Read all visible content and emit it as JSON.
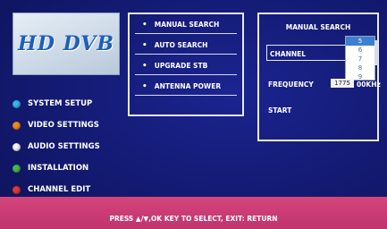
{
  "logo": {
    "text": "HD DVB"
  },
  "main_menu": {
    "items": [
      {
        "label": "SYSTEM SETUP",
        "color": "#35b5e8"
      },
      {
        "label": "VIDEO SETTINGS",
        "color": "#f08a1e"
      },
      {
        "label": "AUDIO SETTINGS",
        "color": "#f2f2f2"
      },
      {
        "label": "INSTALLATION",
        "color": "#46b84c"
      },
      {
        "label": "CHANNEL EDIT",
        "color": "#e23a34"
      }
    ]
  },
  "submenu": {
    "bullet": "•",
    "items": [
      {
        "label": "MANUAL SEARCH"
      },
      {
        "label": "AUTO SEARCH"
      },
      {
        "label": "UPGRADE STB"
      },
      {
        "label": "ANTENNA POWER"
      }
    ]
  },
  "manual_search": {
    "title": "MANUAL SEARCH",
    "channel_label": "CHANNEL",
    "frequency_label": "FREQUENCY",
    "frequency_value": "1775",
    "frequency_unit": "00KHz",
    "start_label": "START",
    "dropdown_options": [
      "5",
      "6",
      "7",
      "8",
      "9"
    ],
    "dropdown_selected_index": 0
  },
  "help": {
    "text": "PRESS ▲/▼,OK KEY TO SELECT, EXIT: RETURN"
  }
}
